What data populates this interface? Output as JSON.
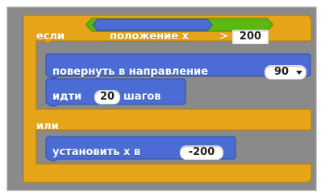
{
  "if_else_block": {
    "if_label": "если",
    "else_label": "или"
  },
  "condition": {
    "reporter_label": "положение x",
    "operator": ">",
    "value": "200"
  },
  "then_blocks": [
    {
      "label": "повернуть в направление",
      "value": "90"
    },
    {
      "label_before": "идти",
      "value": "20",
      "label_after": "шагов"
    }
  ],
  "else_blocks": [
    {
      "label": "установить x в",
      "value": "-200"
    }
  ],
  "colors": {
    "control": "#e6a419",
    "motion": "#4a6cd4",
    "operators": "#5cb712",
    "background": "#8a8a8a"
  }
}
